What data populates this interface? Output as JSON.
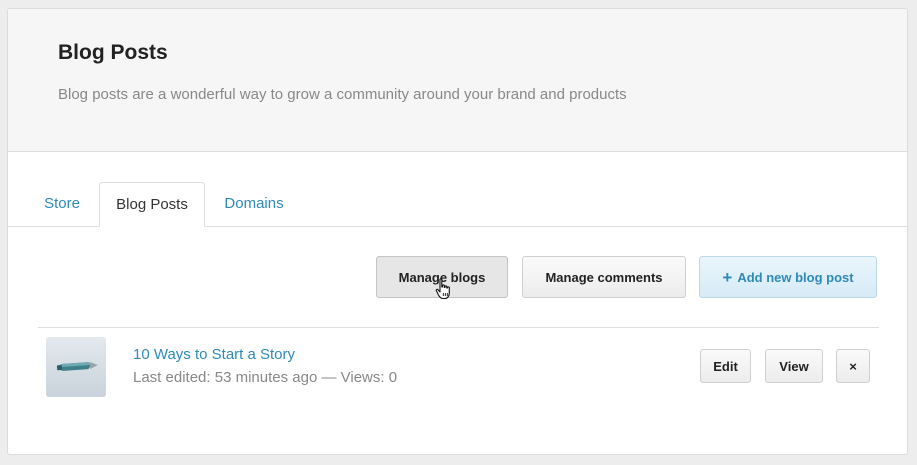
{
  "header": {
    "title": "Blog Posts",
    "subtitle": "Blog posts are a wonderful way to grow a community around your brand and products"
  },
  "tabs": [
    {
      "label": "Store",
      "active": false
    },
    {
      "label": "Blog Posts",
      "active": true
    },
    {
      "label": "Domains",
      "active": false
    }
  ],
  "toolbar": {
    "manage_blogs": "Manage blogs",
    "manage_comments": "Manage comments",
    "add_post_icon": "+",
    "add_post": "Add new blog post"
  },
  "posts": [
    {
      "title": "10 Ways to Start a Story",
      "meta": "Last edited: 53 minutes ago — Views: 0",
      "thumbnail_icon": "pen-image",
      "actions": {
        "edit": "Edit",
        "view": "View",
        "delete": "×"
      }
    }
  ],
  "colors": {
    "accent": "#2e8ab8",
    "header_bg": "#f6f6f6",
    "primary_btn_bg": "#d6ebf6"
  },
  "cursor_icon": "hand-pointer-icon"
}
